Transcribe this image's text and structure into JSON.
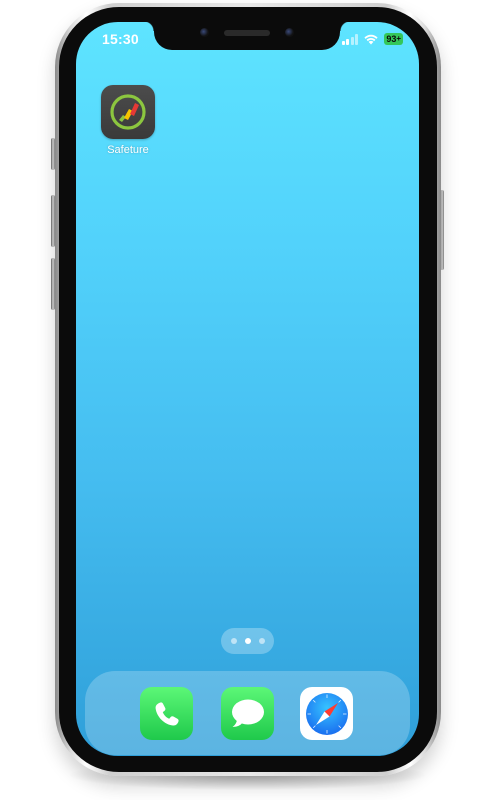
{
  "status_bar": {
    "time": "15:30",
    "battery_level": "93",
    "signal_icon": "cellular-signal-icon",
    "wifi_icon": "wifi-icon"
  },
  "home": {
    "apps": [
      {
        "label": "Safeture",
        "icon": "safeture-app-icon"
      }
    ],
    "page_indicator": {
      "pages": 3,
      "current": 2
    }
  },
  "dock": {
    "apps": [
      {
        "icon": "phone-icon",
        "color": "#2fd158"
      },
      {
        "icon": "messages-icon",
        "color": "#2fd158"
      },
      {
        "icon": "safari-icon",
        "color": "#1a82fb"
      }
    ]
  },
  "colors": {
    "wallpaper_top": "#5ee4ff",
    "wallpaper_bottom": "#2f9fd9",
    "battery": "#34c759"
  }
}
